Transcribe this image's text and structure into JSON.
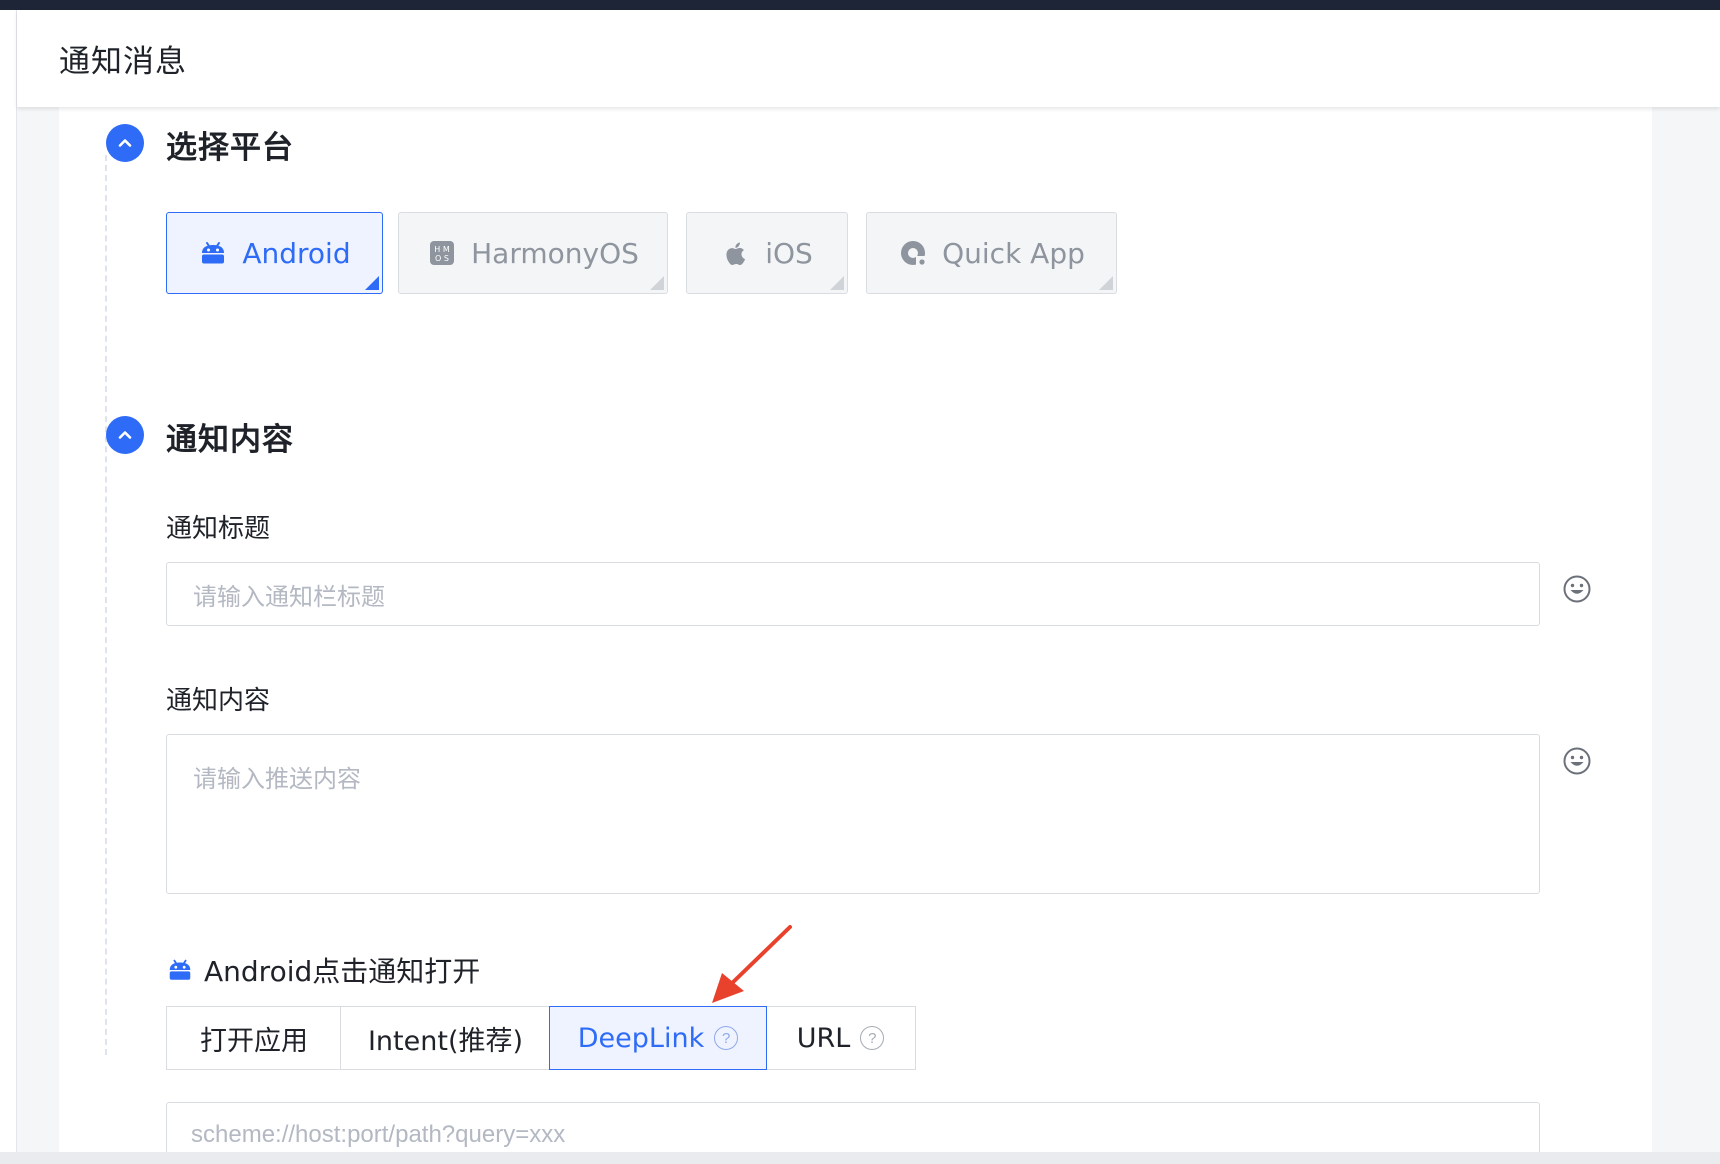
{
  "header": {
    "title": "通知消息"
  },
  "steps": {
    "platform": {
      "title": "选择平台"
    },
    "content": {
      "title": "通知内容"
    }
  },
  "platforms": [
    {
      "label": "Android",
      "icon": "android-icon",
      "selected": true
    },
    {
      "label": "HarmonyOS",
      "icon": "harmonyos-icon",
      "selected": false
    },
    {
      "label": "iOS",
      "icon": "apple-icon",
      "selected": false
    },
    {
      "label": "Quick App",
      "icon": "quick-app-icon",
      "selected": false
    }
  ],
  "notification_title": {
    "label": "通知标题",
    "placeholder": "请输入通知栏标题",
    "value": ""
  },
  "notification_content": {
    "label": "通知内容",
    "placeholder": "请输入推送内容",
    "value": ""
  },
  "click_action": {
    "label": "Android点击通知打开",
    "options": [
      {
        "label": "打开应用",
        "selected": false,
        "help": false
      },
      {
        "label": "Intent(推荐)",
        "selected": false,
        "help": false
      },
      {
        "label": "DeepLink",
        "selected": true,
        "help": true
      },
      {
        "label": "URL",
        "selected": false,
        "help": true
      }
    ],
    "help_mark": "?",
    "deeplink_placeholder": "scheme://host:port/path?query=xxx"
  },
  "colors": {
    "accent": "#2e6bf6",
    "annotation_arrow": "#e8412c"
  }
}
